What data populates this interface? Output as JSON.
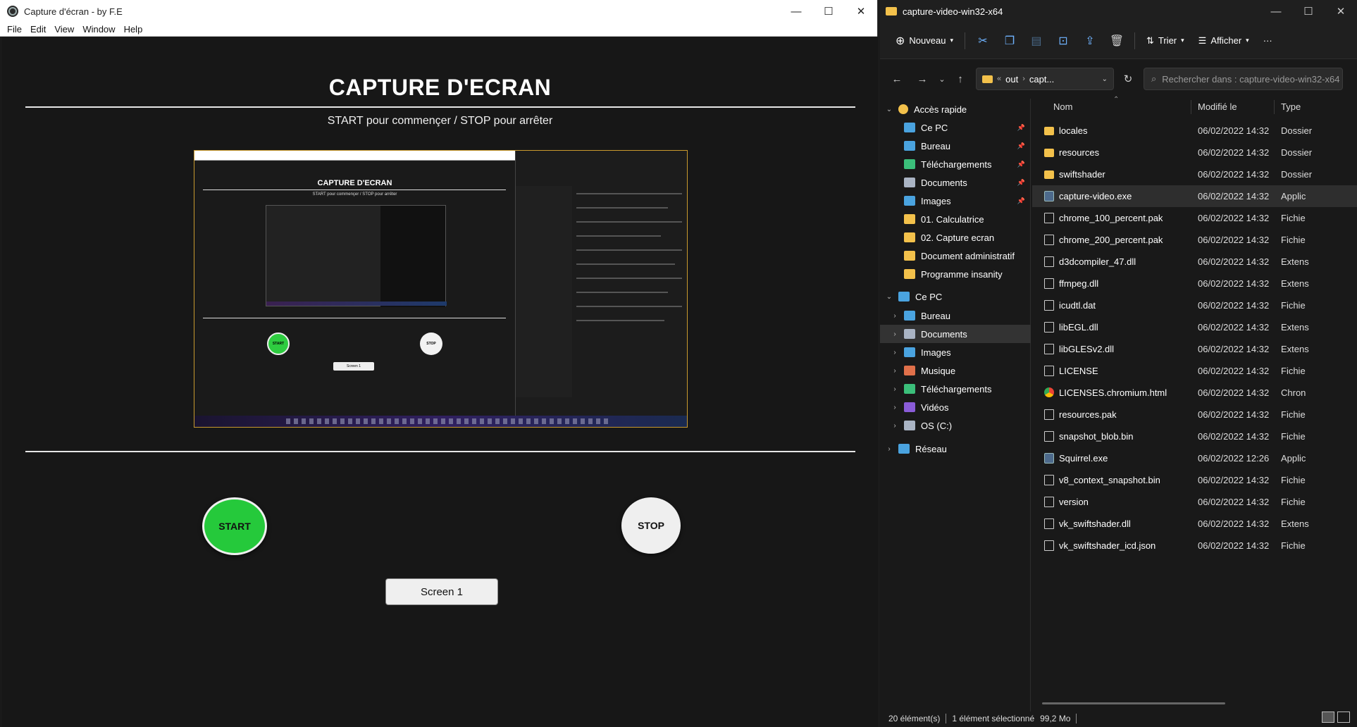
{
  "app": {
    "title": "Capture d'écran - by F.E",
    "menu": [
      "File",
      "Edit",
      "View",
      "Window",
      "Help"
    ],
    "heading": "CAPTURE D'ECRAN",
    "subtitle": "START pour commençer / STOP pour arrêter",
    "start_label": "START",
    "stop_label": "STOP",
    "screen_label": "Screen 1",
    "preview": {
      "heading": "CAPTURE D'ECRAN",
      "subtitle": "START pour commençer / STOP pour arrêter",
      "start_label": "START",
      "stop_label": "STOP",
      "screen_label": "Screen 1"
    }
  },
  "explorer": {
    "title": "capture-video-win32-x64",
    "toolbar": {
      "new_label": "Nouveau",
      "sort_label": "Trier",
      "view_label": "Afficher",
      "more_label": "···"
    },
    "address": {
      "crumb_sep": "«",
      "part1": "out",
      "part2": "capt..."
    },
    "search_placeholder": "Rechercher dans : capture-video-win32-x64",
    "nav": [
      {
        "label": "Accès rapide",
        "icon": "star-icon",
        "chev": "⌄",
        "depth": 0
      },
      {
        "label": "Ce PC",
        "icon": "pc-icon",
        "pin": true,
        "depth": 1
      },
      {
        "label": "Bureau",
        "icon": "desktop-icon",
        "pin": true,
        "depth": 1
      },
      {
        "label": "Téléchargements",
        "icon": "download-icon",
        "pin": true,
        "depth": 1
      },
      {
        "label": "Documents",
        "icon": "documents-icon",
        "pin": true,
        "depth": 1
      },
      {
        "label": "Images",
        "icon": "images-icon",
        "pin": true,
        "depth": 1
      },
      {
        "label": "01. Calculatrice",
        "icon": "folder-icon",
        "depth": 1
      },
      {
        "label": "02. Capture ecran",
        "icon": "folder-icon",
        "depth": 1
      },
      {
        "label": "Document administratif",
        "icon": "folder-icon",
        "depth": 1
      },
      {
        "label": "Programme insanity",
        "icon": "folder-icon",
        "depth": 1
      },
      {
        "label": "Ce PC",
        "icon": "pc-icon",
        "chev": "⌄",
        "depth": 0
      },
      {
        "label": "Bureau",
        "icon": "desktop-icon",
        "chev": "›",
        "depth": 1
      },
      {
        "label": "Documents",
        "icon": "documents-icon",
        "chev": "›",
        "depth": 1,
        "selected": true
      },
      {
        "label": "Images",
        "icon": "images-icon",
        "chev": "›",
        "depth": 1
      },
      {
        "label": "Musique",
        "icon": "music-icon",
        "chev": "›",
        "depth": 1
      },
      {
        "label": "Téléchargements",
        "icon": "download-icon",
        "chev": "›",
        "depth": 1
      },
      {
        "label": "Vidéos",
        "icon": "videos-icon",
        "chev": "›",
        "depth": 1
      },
      {
        "label": "OS (C:)",
        "icon": "drive-icon",
        "chev": "›",
        "depth": 1
      },
      {
        "label": "Réseau",
        "icon": "network-icon",
        "chev": "›",
        "depth": 0
      }
    ],
    "columns": {
      "name": "Nom",
      "modified": "Modifié le",
      "type": "Type"
    },
    "files": [
      {
        "name": "locales",
        "date": "06/02/2022 14:32",
        "type": "Dossier",
        "icon": "folder"
      },
      {
        "name": "resources",
        "date": "06/02/2022 14:32",
        "type": "Dossier",
        "icon": "folder"
      },
      {
        "name": "swiftshader",
        "date": "06/02/2022 14:32",
        "type": "Dossier",
        "icon": "folder"
      },
      {
        "name": "capture-video.exe",
        "date": "06/02/2022 14:32",
        "type": "Applic",
        "icon": "exe",
        "selected": true
      },
      {
        "name": "chrome_100_percent.pak",
        "date": "06/02/2022 14:32",
        "type": "Fichie",
        "icon": "file"
      },
      {
        "name": "chrome_200_percent.pak",
        "date": "06/02/2022 14:32",
        "type": "Fichie",
        "icon": "file"
      },
      {
        "name": "d3dcompiler_47.dll",
        "date": "06/02/2022 14:32",
        "type": "Extens",
        "icon": "file"
      },
      {
        "name": "ffmpeg.dll",
        "date": "06/02/2022 14:32",
        "type": "Extens",
        "icon": "file"
      },
      {
        "name": "icudtl.dat",
        "date": "06/02/2022 14:32",
        "type": "Fichie",
        "icon": "file"
      },
      {
        "name": "libEGL.dll",
        "date": "06/02/2022 14:32",
        "type": "Extens",
        "icon": "file"
      },
      {
        "name": "libGLESv2.dll",
        "date": "06/02/2022 14:32",
        "type": "Extens",
        "icon": "file"
      },
      {
        "name": "LICENSE",
        "date": "06/02/2022 14:32",
        "type": "Fichie",
        "icon": "file"
      },
      {
        "name": "LICENSES.chromium.html",
        "date": "06/02/2022 14:32",
        "type": "Chron",
        "icon": "chrome"
      },
      {
        "name": "resources.pak",
        "date": "06/02/2022 14:32",
        "type": "Fichie",
        "icon": "file"
      },
      {
        "name": "snapshot_blob.bin",
        "date": "06/02/2022 14:32",
        "type": "Fichie",
        "icon": "file"
      },
      {
        "name": "Squirrel.exe",
        "date": "06/02/2022 12:26",
        "type": "Applic",
        "icon": "exe"
      },
      {
        "name": "v8_context_snapshot.bin",
        "date": "06/02/2022 14:32",
        "type": "Fichie",
        "icon": "file"
      },
      {
        "name": "version",
        "date": "06/02/2022 14:32",
        "type": "Fichie",
        "icon": "file"
      },
      {
        "name": "vk_swiftshader.dll",
        "date": "06/02/2022 14:32",
        "type": "Extens",
        "icon": "file"
      },
      {
        "name": "vk_swiftshader_icd.json",
        "date": "06/02/2022 14:32",
        "type": "Fichie",
        "icon": "file"
      }
    ],
    "status": {
      "count": "20 élément(s)",
      "selection": "1 élément sélectionné",
      "size": "99,2 Mo"
    },
    "colors": {
      "folder": "#f3c14b",
      "accent": "#6fb3ff",
      "start_green": "#25c93b"
    }
  }
}
